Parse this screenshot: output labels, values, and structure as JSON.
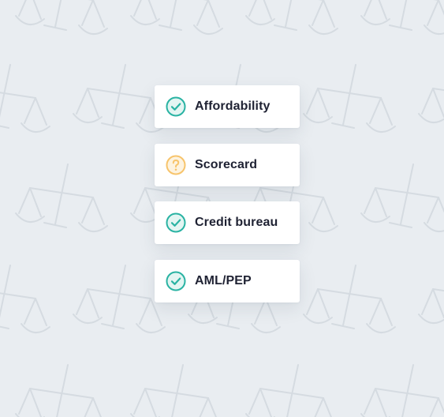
{
  "colors": {
    "background": "#e9edf1",
    "pattern_stroke": "#d5dbe1",
    "pass": "#2ab3a3",
    "pending": "#f7c46c",
    "label": "#1f2233",
    "card": "#ffffff"
  },
  "checks": [
    {
      "label": "Affordability",
      "status": "passed",
      "icon": "check-circle-icon"
    },
    {
      "label": "Scorecard",
      "status": "pending",
      "icon": "question-circle-icon"
    },
    {
      "label": "Credit bureau",
      "status": "passed",
      "icon": "check-circle-icon"
    },
    {
      "label": "AML/PEP",
      "status": "passed",
      "icon": "check-circle-icon"
    }
  ]
}
